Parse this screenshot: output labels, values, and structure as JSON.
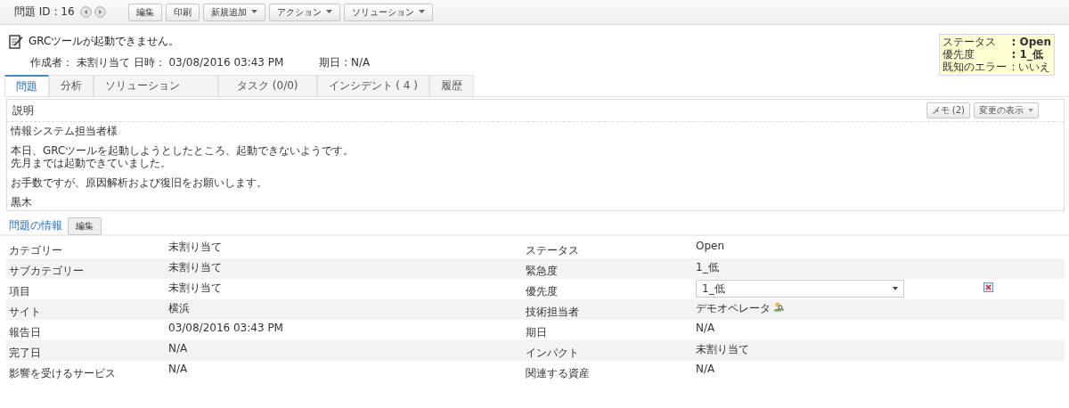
{
  "toolbar": {
    "problem_id": "問題 ID : 16",
    "buttons": [
      {
        "label": "編集",
        "dropdown": false
      },
      {
        "label": "印刷",
        "dropdown": false
      },
      {
        "label": "新規追加",
        "dropdown": true
      },
      {
        "label": "アクション",
        "dropdown": true
      },
      {
        "label": "ソリューション",
        "dropdown": true
      }
    ]
  },
  "header": {
    "title": "GRCツールが起動できません。",
    "meta": "作成者： 未割り当て  日時： 03/08/2016 03:43 PM",
    "due": "期日 : N/A",
    "summary": [
      {
        "label": "ステータス",
        "value": ": Open"
      },
      {
        "label": "優先度",
        "value": ": 1_低"
      },
      {
        "label": "既知のエラー",
        "value": ": いいえ"
      }
    ]
  },
  "tabs": [
    {
      "label": "問題",
      "selected": true
    },
    {
      "label": "分析",
      "selected": false
    },
    {
      "label": "ソリューション",
      "selected": false
    },
    {
      "label": "タスク (0/0)",
      "selected": false
    },
    {
      "label": "インシデント ( 4 )",
      "selected": false
    },
    {
      "label": "履歴",
      "selected": false
    }
  ],
  "description": {
    "title": "説明",
    "buttons": [
      {
        "label": "メモ (2)",
        "dropdown": false
      },
      {
        "label": "変更の表示",
        "dropdown": true
      }
    ],
    "paragraphs": [
      [
        "情報システム担当者様"
      ],
      [
        "本日、GRCツールを起動しようとしたところ、起動できないようです。",
        "先月までは起動できていました。"
      ],
      [
        "お手数ですが、原因解析および復旧をお願いします。"
      ],
      [
        "黒木"
      ]
    ]
  },
  "info": {
    "title": "問題の情報",
    "edit_button": "編集",
    "rows": [
      {
        "label": "カテゴリー",
        "value": "未割り当て",
        "label_2": "ステータス",
        "value_2": "Open",
        "kind": "text"
      },
      {
        "label": "サブカテゴリー",
        "value": "未割り当て",
        "label_2": "緊急度",
        "value_2": "1_低",
        "kind": "text"
      },
      {
        "label": "項目",
        "value": "未割り当て",
        "label_2": "優先度",
        "value_2": "1_低",
        "kind": "select"
      },
      {
        "label": "サイト",
        "value": "横浜",
        "label_2": "技術担当者",
        "value_2": "デモオペレータ",
        "kind": "user"
      },
      {
        "label": "報告日",
        "value": "03/08/2016 03:43 PM",
        "label_2": "期日",
        "value_2": "N/A",
        "kind": "text"
      },
      {
        "label": "完了日",
        "value": "N/A",
        "label_2": "インパクト",
        "value_2": "未割り当て",
        "kind": "text"
      },
      {
        "label": "影響を受けるサービス",
        "value": "N/A",
        "label_2": "関連する資産",
        "value_2": "N/A",
        "kind": "text"
      }
    ]
  }
}
